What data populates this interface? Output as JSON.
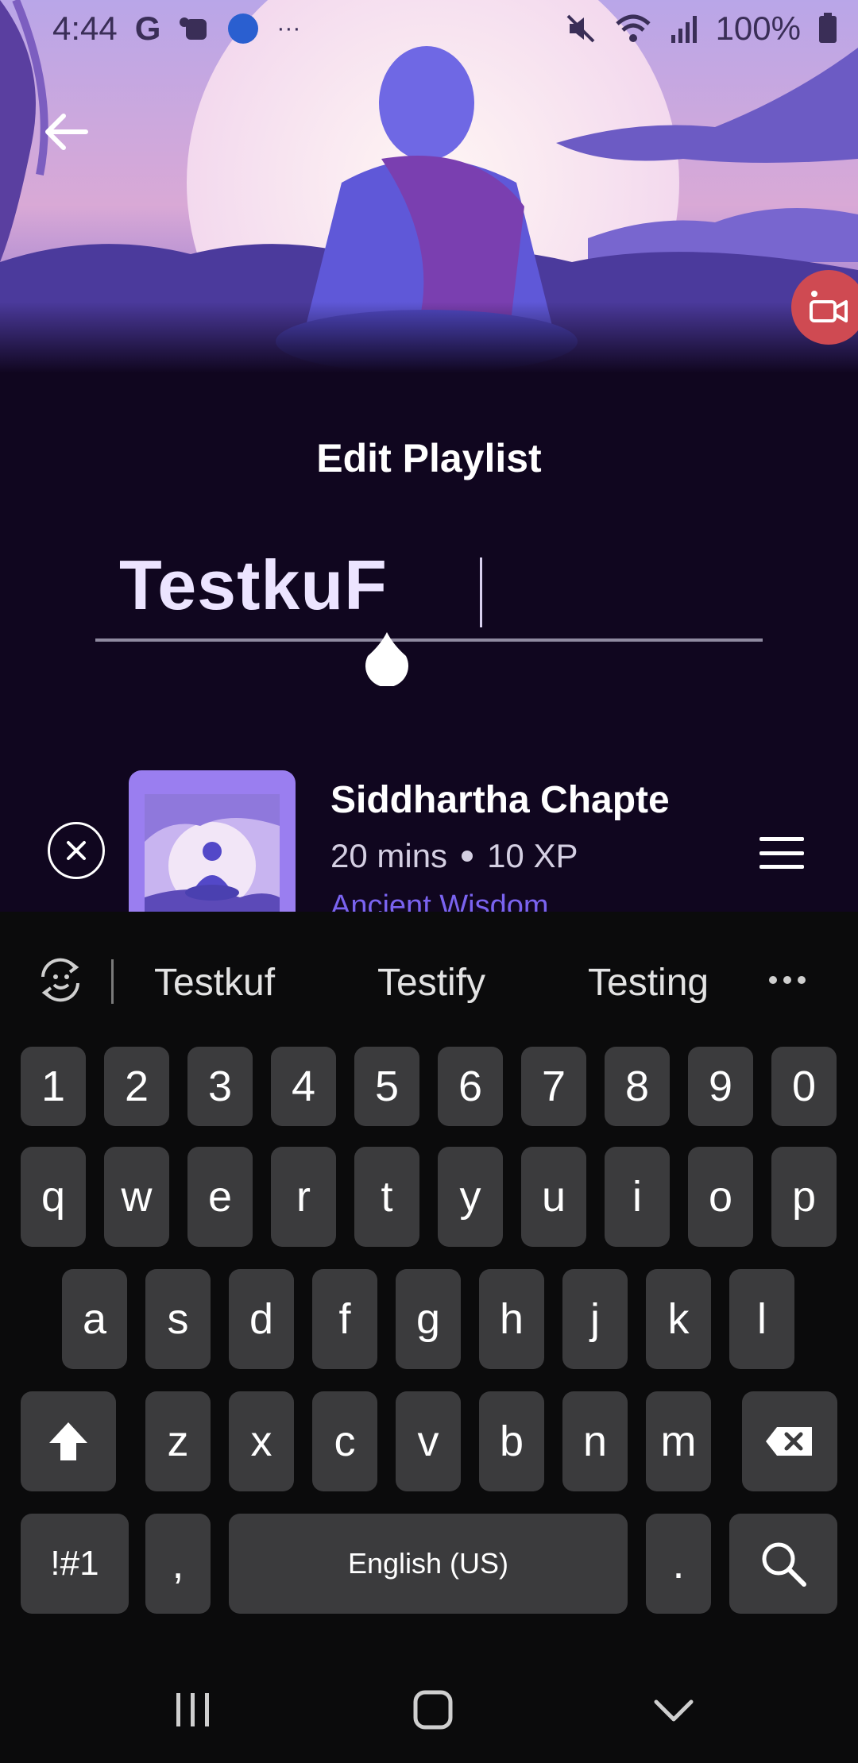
{
  "status_bar": {
    "time": "4:44",
    "battery": "100%",
    "overflow": "···",
    "icons": [
      "google-icon",
      "teams-icon",
      "app-icon",
      "mute-icon",
      "wifi-icon",
      "signal-icon",
      "battery-icon"
    ]
  },
  "header": {
    "title": "Edit Playlist",
    "back_icon": "arrow-left-icon",
    "record_icon": "video-record-icon"
  },
  "playlist_name": {
    "value": "TestkuF"
  },
  "track": {
    "title": "Siddhartha Chapte",
    "duration": "20 mins",
    "xp": "10 XP",
    "category": "Ancient Wisdom",
    "remove_icon": "close-icon",
    "reorder_icon": "drag-handle-icon"
  },
  "keyboard": {
    "suggestions": [
      "Testkuf",
      "Testify",
      "Testing"
    ],
    "number_row": [
      "1",
      "2",
      "3",
      "4",
      "5",
      "6",
      "7",
      "8",
      "9",
      "0"
    ],
    "row1": [
      "q",
      "w",
      "e",
      "r",
      "t",
      "y",
      "u",
      "i",
      "o",
      "p"
    ],
    "row2": [
      "a",
      "s",
      "d",
      "f",
      "g",
      "h",
      "j",
      "k",
      "l"
    ],
    "row3": [
      "z",
      "x",
      "c",
      "v",
      "b",
      "n",
      "m"
    ],
    "symbols_key": "!#1",
    "comma_key": ",",
    "space_key": "English (US)",
    "period_key": "."
  },
  "colors": {
    "background": "#10061f",
    "accent": "#7a63f0",
    "keyboard_bg": "#0b0b0c",
    "key_bg": "#3b3b3d",
    "record_button": "#cf4a52"
  }
}
